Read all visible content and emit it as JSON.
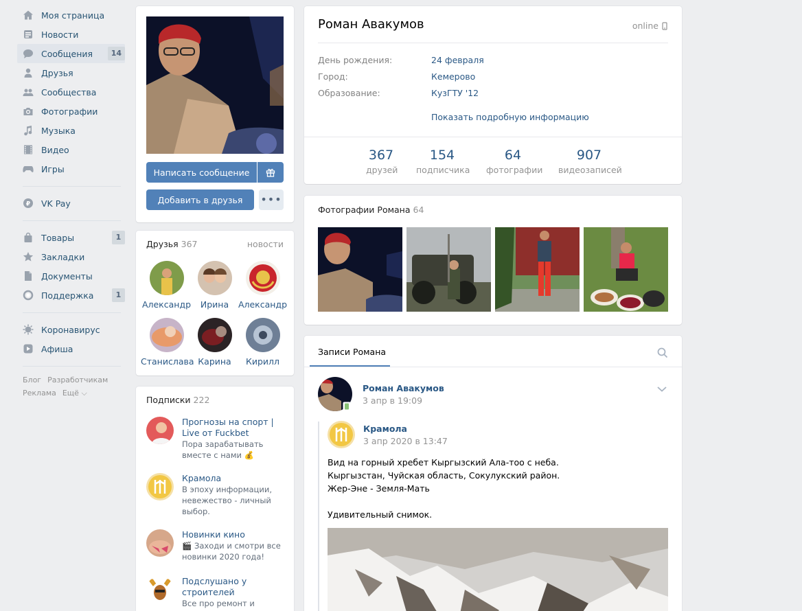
{
  "menu": {
    "items": [
      {
        "label": "Моя страница",
        "icon": "home-icon"
      },
      {
        "label": "Новости",
        "icon": "news-icon"
      },
      {
        "label": "Сообщения",
        "icon": "messages-icon",
        "badge": "14"
      },
      {
        "label": "Друзья",
        "icon": "friends-icon"
      },
      {
        "label": "Сообщества",
        "icon": "groups-icon"
      },
      {
        "label": "Фотографии",
        "icon": "camera-icon"
      },
      {
        "label": "Музыка",
        "icon": "music-icon"
      },
      {
        "label": "Видео",
        "icon": "video-icon"
      },
      {
        "label": "Игры",
        "icon": "gamepad-icon"
      }
    ],
    "pay": {
      "label": "VK Pay",
      "icon": "vkpay-icon"
    },
    "items2": [
      {
        "label": "Товары",
        "icon": "bag-icon",
        "badge": "1"
      },
      {
        "label": "Закладки",
        "icon": "star-icon"
      },
      {
        "label": "Документы",
        "icon": "document-icon"
      },
      {
        "label": "Поддержка",
        "icon": "support-icon",
        "badge": "1"
      }
    ],
    "items3": [
      {
        "label": "Коронавирус",
        "icon": "virus-icon"
      },
      {
        "label": "Афиша",
        "icon": "play-icon"
      }
    ],
    "footer": {
      "blog": "Блог",
      "dev": "Разработчикам",
      "ads": "Реклама",
      "more": "Ещё"
    }
  },
  "profile": {
    "write_message": "Написать сообщение",
    "add_friend": "Добавить в друзья",
    "name": "Роман Авакумов",
    "status": "online",
    "info": [
      {
        "label": "День рождения:",
        "value": "24 февраля"
      },
      {
        "label": "Город:",
        "value": "Кемерово"
      },
      {
        "label": "Образование:",
        "value": "КузГТУ '12"
      }
    ],
    "show_more": "Показать подробную информацию",
    "stats": [
      {
        "num": "367",
        "label": "друзей"
      },
      {
        "num": "154",
        "label": "подписчика"
      },
      {
        "num": "64",
        "label": "фотографии"
      },
      {
        "num": "907",
        "label": "видеозаписей"
      }
    ]
  },
  "friends": {
    "title": "Друзья",
    "count": "367",
    "link": "новости",
    "list": [
      "Александр",
      "Ирина",
      "Александр",
      "Станислава",
      "Карина",
      "Кирилл"
    ]
  },
  "subs": {
    "title": "Подписки",
    "count": "222",
    "list": [
      {
        "title": "Прогнозы на спорт | Live от Fuckbet",
        "desc": "Пора зарабатывать вместе с нами 💰"
      },
      {
        "title": "Крамола",
        "desc": "В эпоху информации, невежество - личный выбор."
      },
      {
        "title": "Новинки кино",
        "desc": "🎬 Заходи и смотри все новинки 2020 года!"
      },
      {
        "title": "Подслушано у строителей",
        "desc": "Все про ремонт и"
      }
    ]
  },
  "photos": {
    "title": "Фотографии Романа",
    "count": "64"
  },
  "wall": {
    "tab": "Записи Романа",
    "post": {
      "author": "Роман Авакумов",
      "date": "3 апр в 19:09",
      "repost_author": "Крамола",
      "repost_date": "3 апр 2020 в 13:47",
      "text": [
        "Вид на горный хребет Кыргызский Ала-тоо с неба.",
        "Кыргызстан, Чуйская область, Сокулукский район.",
        "Жер-Эне - Земля-Мать",
        "",
        "Удивительный снимок."
      ]
    }
  }
}
